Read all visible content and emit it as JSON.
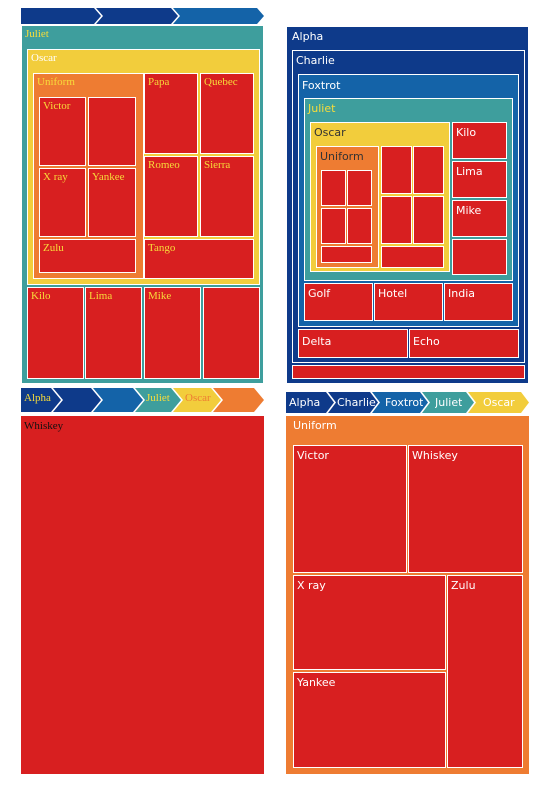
{
  "colors": {
    "navy": "#0e3a8a",
    "blue": "#1463a8",
    "teal": "#3e9e9d",
    "yellow": "#f2cd3c",
    "orange": "#ee7c32",
    "red": "#d81f20",
    "yellowText": "#f7dc3a",
    "white": "#ffffff",
    "black": "#111111"
  },
  "panels": {
    "p1": {
      "breadcrumb": [
        "",
        "",
        ""
      ],
      "labels": {
        "juliet": "Juliet",
        "oscar": "Oscar",
        "uniform": "Uniform",
        "victor": "Victor",
        "xray": "X ray",
        "yankee": "Yankee",
        "zulu": "Zulu",
        "papa": "Papa",
        "quebec": "Quebec",
        "romeo": "Romeo",
        "sierra": "Sierra",
        "tango": "Tango",
        "kilo": "Kilo",
        "lima": "Lima",
        "mike": "Mike"
      }
    },
    "p2": {
      "labels": {
        "alpha": "Alpha",
        "charlie": "Charlie",
        "foxtrot": "Foxtrot",
        "juliet": "Juliet",
        "oscar": "Oscar",
        "uniform": "Uniform",
        "kilo": "Kilo",
        "lima": "Lima",
        "mike": "Mike",
        "golf": "Golf",
        "hotel": "Hotel",
        "india": "India",
        "delta": "Delta",
        "echo": "Echo"
      }
    },
    "p3": {
      "breadcrumb": [
        "Alpha",
        "",
        "",
        "Juliet",
        "Oscar",
        ""
      ],
      "labels": {
        "whiskey": "Whiskey"
      }
    },
    "p4": {
      "breadcrumb": [
        "Alpha",
        "Charlie",
        "Foxtrot",
        "Juliet",
        "Oscar"
      ],
      "labels": {
        "uniform": "Uniform",
        "victor": "Victor",
        "whiskey": "Whiskey",
        "xray": "X ray",
        "zulu": "Zulu",
        "yankee": "Yankee"
      }
    }
  }
}
